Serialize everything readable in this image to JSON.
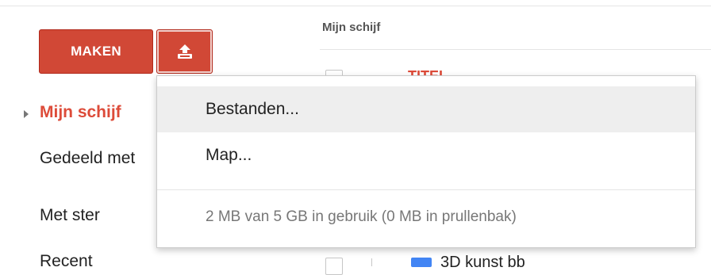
{
  "header": {
    "title": "Mijn schijf"
  },
  "toolbar": {
    "maken_label": "MAKEN",
    "upload_icon": "upload-icon"
  },
  "sidebar": {
    "items": [
      {
        "label": "Mijn schijf",
        "active": true
      },
      {
        "label": "Gedeeld met"
      },
      {
        "label": "Met ster"
      },
      {
        "label": "Recent"
      }
    ]
  },
  "file_list": {
    "rows": [
      {
        "name": "TITEL"
      },
      {
        "name": "3D kunst bb"
      }
    ]
  },
  "upload_menu": {
    "items": [
      {
        "label": "Bestanden...",
        "highlighted": true
      },
      {
        "label": "Map..."
      }
    ],
    "quota": "2 MB van 5 GB in gebruik (0 MB in prullenbak)"
  },
  "colors": {
    "accent": "#d14836",
    "active_nav": "#dd4b39",
    "folder": "#4285f4"
  }
}
